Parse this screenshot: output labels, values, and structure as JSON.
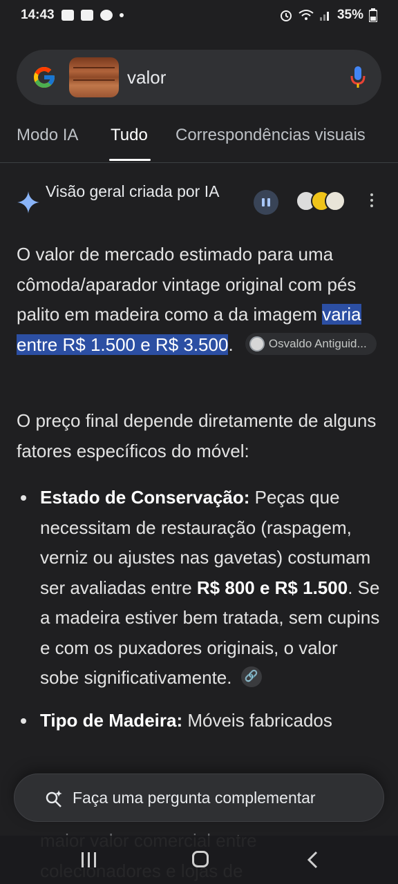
{
  "status_bar": {
    "time": "14:43",
    "battery": "35%"
  },
  "search": {
    "query": "valor"
  },
  "tabs": [
    {
      "label": "Modo IA",
      "active": false
    },
    {
      "label": "Tudo",
      "active": true
    },
    {
      "label": "Correspondências visuais",
      "active": false
    }
  ],
  "overview": {
    "title": "Visão geral criada por IA"
  },
  "paragraph1": {
    "before": "O valor de mercado estimado para uma cômoda/aparador vintage original com pés palito em madeira como a da imagem ",
    "highlight": "varia entre R$ 1.500 e R$ 3.500",
    "after": ".",
    "source_chip": "Osvaldo Antiguid..."
  },
  "paragraph2": "O preço final depende diretamente de alguns fatores específicos do móvel:",
  "bullets": [
    {
      "bold": "Estado de Conservação:",
      "text1": " Peças que necessitam de restauração (raspagem, verniz ou ajustes nas gavetas) costumam ser avaliadas entre ",
      "bold2": "R$ 800 e R$ 1.500",
      "text2": ". Se a madeira estiver bem tratada, sem cupins e com os puxadores originais, o valor sobe significativamente."
    },
    {
      "bold": "Tipo de Madeira:",
      "text1": " Móveis fabricados"
    }
  ],
  "faded_text": "maior valor comercial entre colecionadores e lojas de",
  "followup": {
    "label": "Faça uma pergunta complementar"
  },
  "colors": {
    "background": "#1f1f21",
    "highlight": "#2c4fa3",
    "accent_blue": "#a8c7fa"
  }
}
